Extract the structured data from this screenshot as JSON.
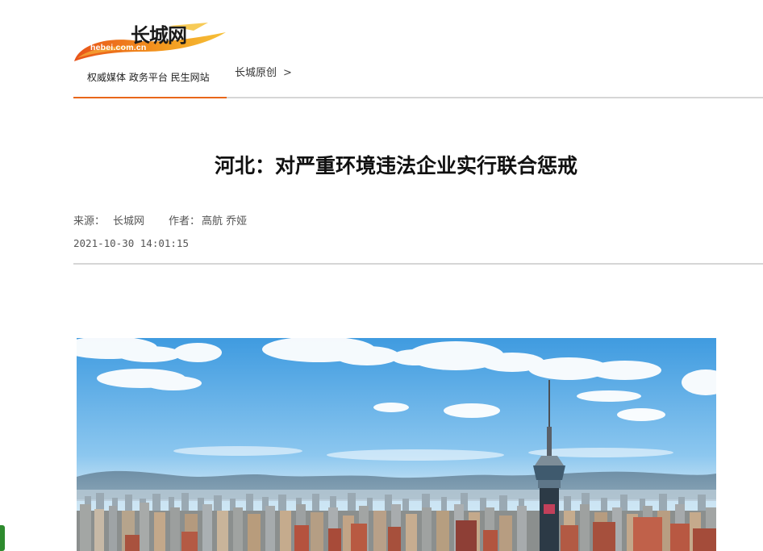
{
  "site": {
    "logo_text": "长城网",
    "logo_domain": "hebei.com.cn",
    "slogan": "权威媒体  政务平台  民生网站",
    "accent_color": "#e8671a"
  },
  "breadcrumb": {
    "section": "长城原创",
    "separator": ">"
  },
  "article": {
    "title": "河北：对严重环境违法企业实行联合惩戒",
    "source_label": "来源：",
    "source": "长城网",
    "author_label": "作者：",
    "author": "高航 乔娅",
    "datetime": "2021-10-30 14:01:15",
    "image_icon": "city-skyline-photo"
  },
  "side_tab": {
    "color": "#2e8b2e"
  }
}
